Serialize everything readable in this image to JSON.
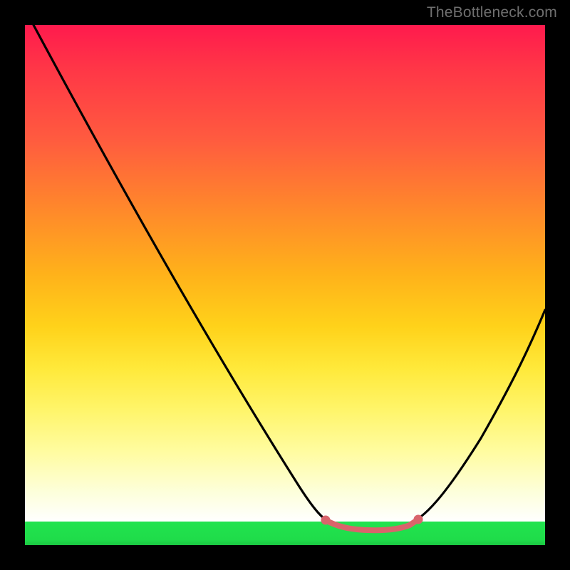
{
  "watermark": "TheBottleneck.com",
  "chart_data": {
    "type": "line",
    "title": "",
    "xlabel": "",
    "ylabel": "",
    "xlim": [
      0,
      100
    ],
    "ylim": [
      0,
      100
    ],
    "series": [
      {
        "name": "bottleneck-curve",
        "x": [
          0,
          5,
          12,
          20,
          28,
          36,
          44,
          50,
          55,
          58,
          61,
          64,
          72,
          75,
          78,
          82,
          86,
          92,
          96,
          100
        ],
        "y": [
          100,
          90,
          80,
          68,
          56,
          44,
          32,
          22,
          14,
          8,
          4,
          2,
          2,
          4,
          8,
          14,
          22,
          34,
          42,
          50
        ]
      },
      {
        "name": "highlighted-minimum",
        "x": [
          58,
          60,
          63,
          66,
          69,
          72,
          74,
          76
        ],
        "y": [
          8,
          4,
          2.2,
          2,
          2,
          2.2,
          3.5,
          7
        ]
      }
    ],
    "annotations": [],
    "colors": {
      "curve": "#000000",
      "highlight": "#d9646b",
      "gradient_top": "#ff1a4d",
      "gradient_mid": "#ffe93a",
      "gradient_bottom": "#1fdc4a"
    }
  }
}
